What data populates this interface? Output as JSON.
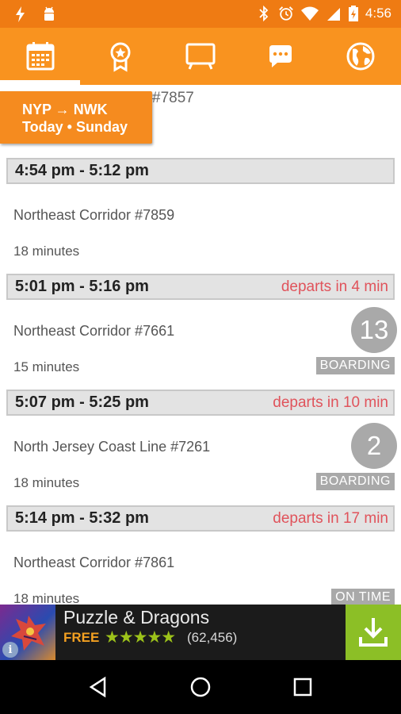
{
  "status_bar": {
    "time": "4:56",
    "icons": [
      "flash-icon",
      "android-icon",
      "bluetooth-icon",
      "alarm-icon",
      "wifi-icon",
      "signal-icon",
      "battery-charging-icon"
    ]
  },
  "tabs": [
    {
      "name": "schedule-calendar-icon",
      "active": true
    },
    {
      "name": "rewards-badge-icon",
      "active": false
    },
    {
      "name": "tv-departures-icon",
      "active": false
    },
    {
      "name": "chat-icon",
      "active": false
    },
    {
      "name": "globe-icon",
      "active": false
    }
  ],
  "route_card": {
    "from_to": "NYP → NWK",
    "day": "Today • Sunday"
  },
  "partial_row_text": "#7857",
  "trips": [
    {
      "time": "4:54 pm - 5:12 pm",
      "depart": "",
      "line": "Northeast Corridor #7859",
      "duration": "18 minutes",
      "track": "",
      "status": ""
    },
    {
      "time": "5:01 pm - 5:16 pm",
      "depart": "departs in 4 min",
      "line": "Northeast Corridor #7661",
      "duration": "15 minutes",
      "track": "13",
      "status": "BOARDING"
    },
    {
      "time": "5:07 pm - 5:25 pm",
      "depart": "departs in 10 min",
      "line": "North Jersey Coast Line #7261",
      "duration": "18 minutes",
      "track": "2",
      "status": "BOARDING"
    },
    {
      "time": "5:14 pm - 5:32 pm",
      "depart": "departs in 17 min",
      "line": "Northeast Corridor #7861",
      "duration": "18 minutes",
      "track": "",
      "status": "ON TIME"
    }
  ],
  "ad": {
    "title": "Puzzle & Dragons",
    "price": "FREE",
    "stars": "★★★★★",
    "reviews": "(62,456)",
    "info": "i"
  },
  "colors": {
    "accent": "#f9931f",
    "status_bar": "#ef7b13",
    "depart_red": "#e0535b",
    "badge_gray": "#a9a9a9",
    "download_green": "#8cbf26"
  }
}
